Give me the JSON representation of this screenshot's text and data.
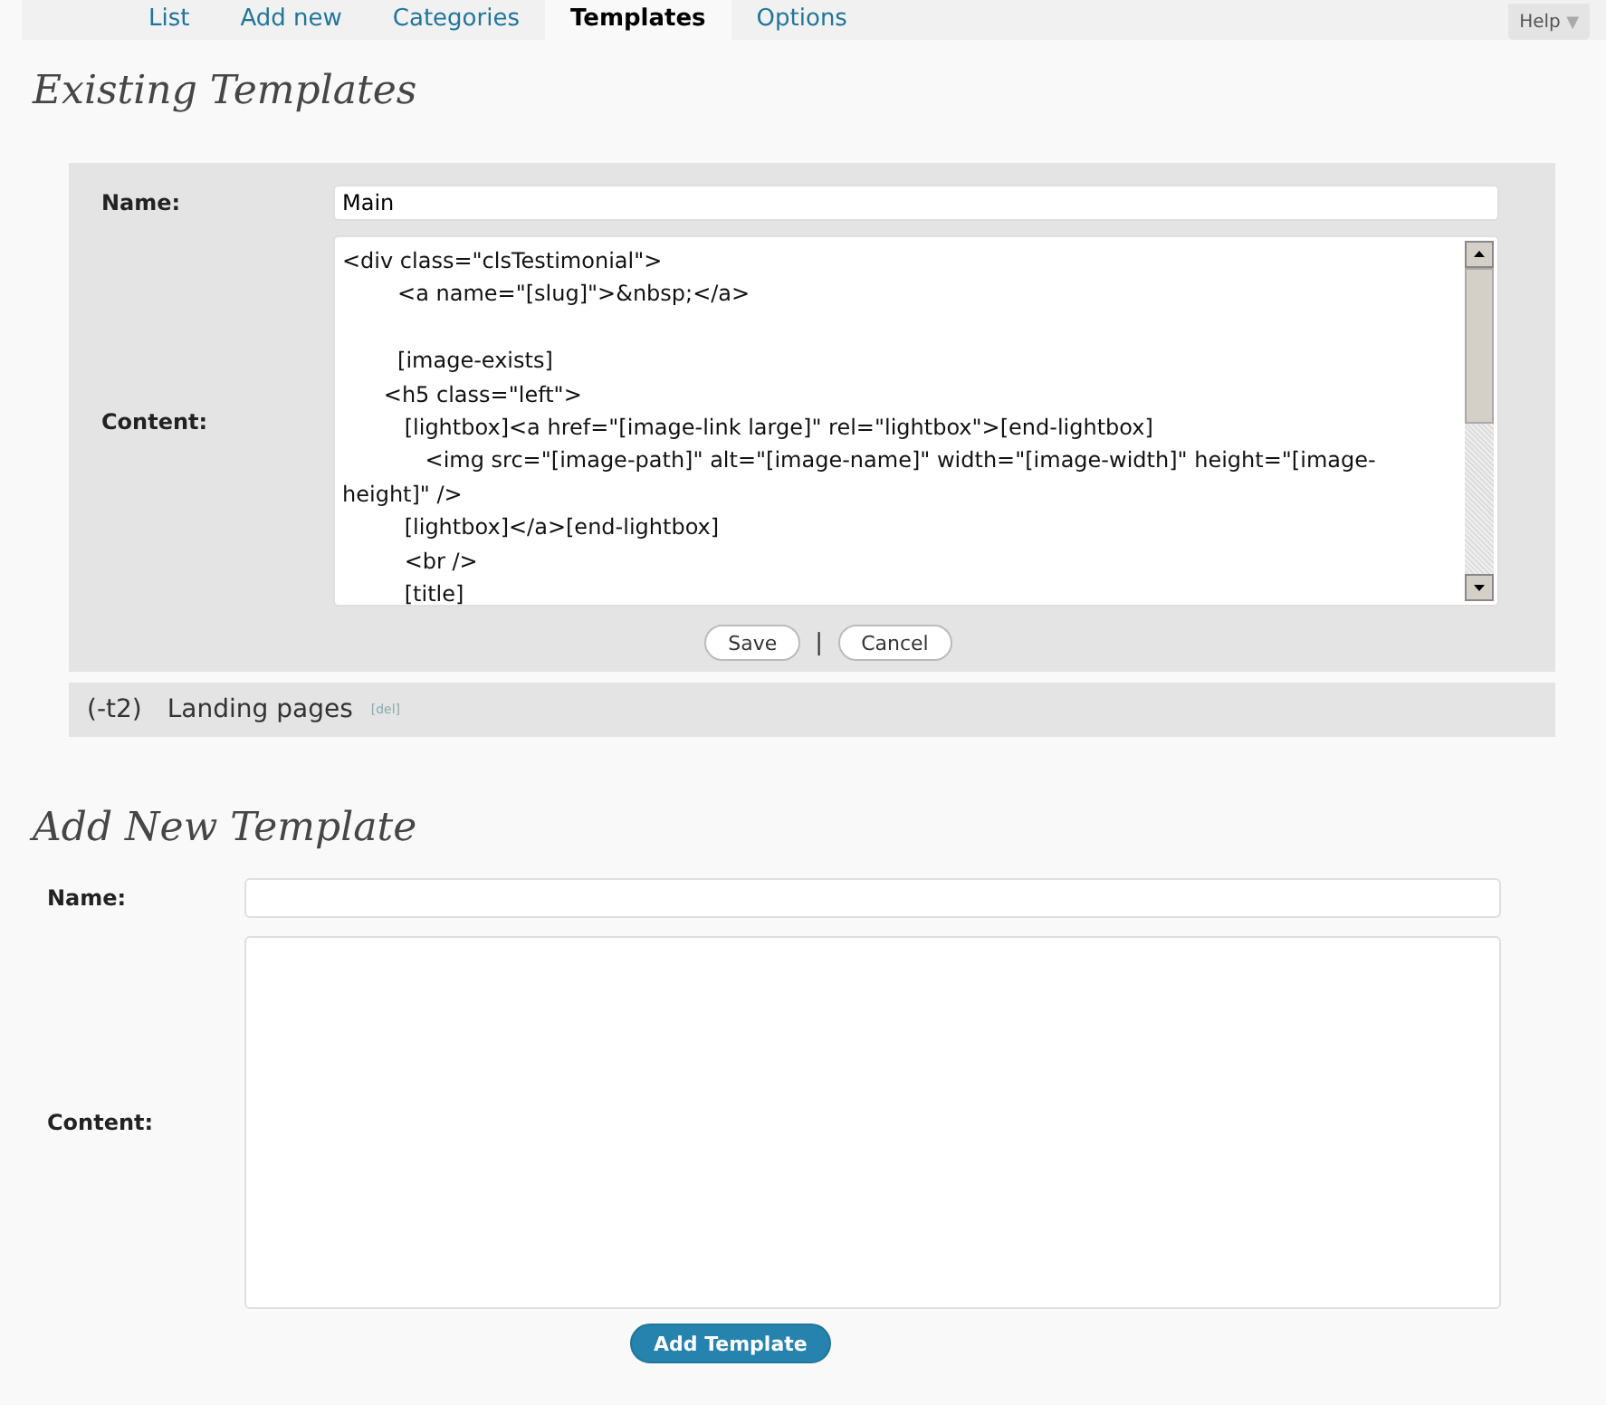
{
  "tabs": [
    {
      "label": "List",
      "selected": false
    },
    {
      "label": "Add new",
      "selected": false
    },
    {
      "label": "Categories",
      "selected": false
    },
    {
      "label": "Templates",
      "selected": true
    },
    {
      "label": "Options",
      "selected": false
    }
  ],
  "help": {
    "label": "Help",
    "icon": "▼"
  },
  "existing": {
    "heading": "Existing Templates",
    "editor": {
      "name_label": "Name:",
      "name_value": "Main",
      "content_label": "Content:",
      "content": "<div class=\"clsTestimonial\">\n        <a name=\"[slug]\">&nbsp;</a>\n\n        [image-exists]\n      <h5 class=\"left\">\n         [lightbox]<a href=\"[image-link large]\" rel=\"lightbox\">[end-lightbox]\n            <img src=\"[image-path]\" alt=\"[image-name]\" width=\"[image-width]\" height=\"[image-height]\" />\n         [lightbox]</a>[end-lightbox]\n         <br />\n         [title]",
      "save": "Save",
      "separator": "|",
      "cancel": "Cancel"
    },
    "templates": [
      {
        "id": "(-t2)",
        "name": "Landing pages",
        "delete": "[del]"
      }
    ]
  },
  "add_new": {
    "heading": "Add New Template",
    "name_label": "Name:",
    "content_label": "Content:",
    "submit": "Add Template"
  }
}
